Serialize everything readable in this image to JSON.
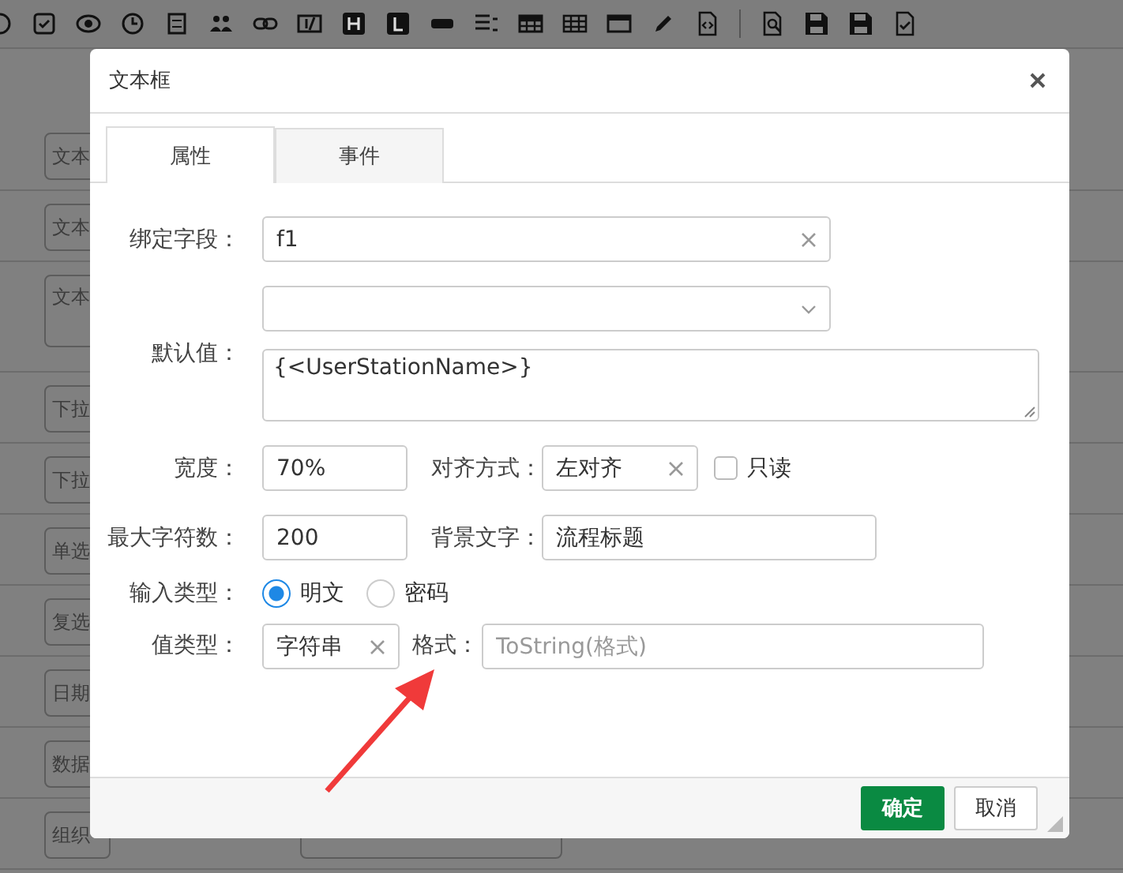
{
  "background": {
    "items": [
      "文本",
      "文本",
      "文本",
      "下拉",
      "下拉",
      "单选",
      "复选",
      "日期",
      "数据",
      "组织"
    ]
  },
  "dialog": {
    "title": "文本框",
    "tabs": [
      {
        "label": "属性",
        "selected": true
      },
      {
        "label": "事件",
        "selected": false
      }
    ],
    "form": {
      "bind_field": {
        "label": "绑定字段：",
        "value": "f1"
      },
      "default_value": {
        "label": "默认值：",
        "value": "{<UserStationName>}"
      },
      "width": {
        "label": "宽度：",
        "value": "70%"
      },
      "align": {
        "label": "对齐方式：",
        "value": "左对齐"
      },
      "readonly": {
        "label": "只读",
        "checked": false
      },
      "max_length": {
        "label": "最大字符数：",
        "value": "200"
      },
      "placeholder_text": {
        "label": "背景文字：",
        "value": "流程标题"
      },
      "input_type": {
        "label": "输入类型：",
        "options": [
          {
            "label": "明文",
            "selected": true
          },
          {
            "label": "密码",
            "selected": false
          }
        ]
      },
      "value_type": {
        "label": "值类型：",
        "value": "字符串"
      },
      "format": {
        "label": "格式：",
        "placeholder": "ToString(格式)"
      }
    },
    "buttons": [
      {
        "label": "确定",
        "kind": "primary"
      },
      {
        "label": "取消",
        "kind": "default"
      }
    ]
  }
}
